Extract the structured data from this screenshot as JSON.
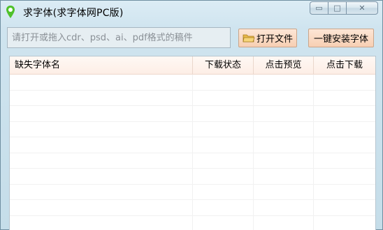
{
  "window": {
    "title": "求字体(求字体网PC版)",
    "controls": {
      "minimize": "▭",
      "maximize": "□",
      "close": "✕"
    }
  },
  "toolbar": {
    "path_placeholder": "请打开或拖入cdr、psd、ai、pdf格式的稿件",
    "path_value": "",
    "open_file_label": "打开文件",
    "install_all_label": "一键安装字体"
  },
  "table": {
    "columns": [
      "缺失字体名",
      "下载状态",
      "点击预览",
      "点击下载"
    ],
    "rows": []
  },
  "colors": {
    "accent_button": "#f7cfb3",
    "header_bg": "#fdeee6",
    "icon_green": "#4fc12a"
  }
}
